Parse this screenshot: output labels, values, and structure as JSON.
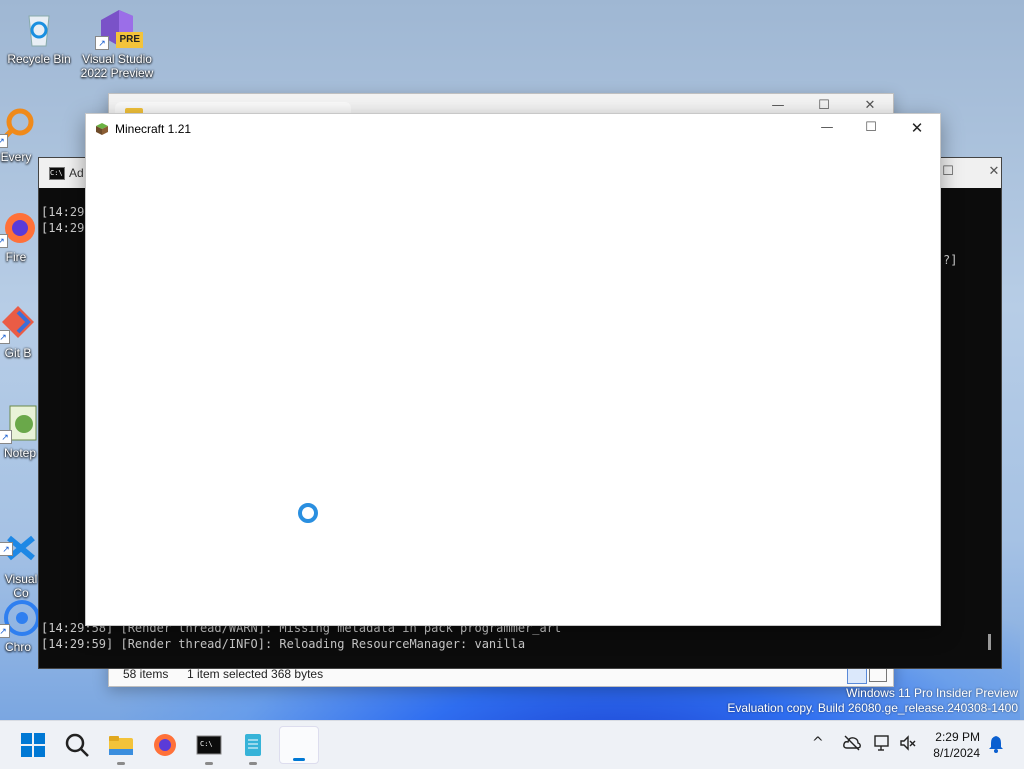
{
  "desktop": {
    "icons": [
      {
        "label": "Recycle Bin"
      },
      {
        "label": "Visual Studio 2022 Preview",
        "badge": "PRE"
      },
      {
        "label": "Every"
      },
      {
        "label": "Fire"
      },
      {
        "label": "Git B"
      },
      {
        "label": "Notep"
      },
      {
        "label": "Visual\nCo"
      },
      {
        "label": "Chro"
      }
    ]
  },
  "explorer": {
    "status_items": "58 items",
    "status_selected": "1 item selected  368 bytes",
    "controls": {
      "min": "—",
      "max": "☐",
      "close": "✕"
    }
  },
  "console": {
    "title": "Ad",
    "lines_top": [
      "[14:29:",
      "[14:29:"
    ],
    "line_right": "?]",
    "lines_bottom": [
      "[14:29:58] [Render thread/WARN]: Missing metadata in pack programmer_art",
      "[14:29:59] [Render thread/INFO]: Reloading ResourceManager: vanilla"
    ],
    "controls": {
      "max": "☐",
      "close": "✕"
    }
  },
  "minecraft": {
    "title": "Minecraft 1.21",
    "controls": {
      "min": "—",
      "max": "☐",
      "close": "✕"
    }
  },
  "taskbar": {
    "clock_time": "2:29 PM",
    "clock_date": "8/1/2024",
    "tray_chevron": "^"
  },
  "watermark": {
    "line1": "Windows 11 Pro Insider Preview",
    "line2": "Evaluation copy. Build 26080.ge_release.240308-1400"
  },
  "colors": {
    "accent": "#0078d4",
    "spinner": "#2a8fe0",
    "console_bg": "#0c0c0c"
  }
}
